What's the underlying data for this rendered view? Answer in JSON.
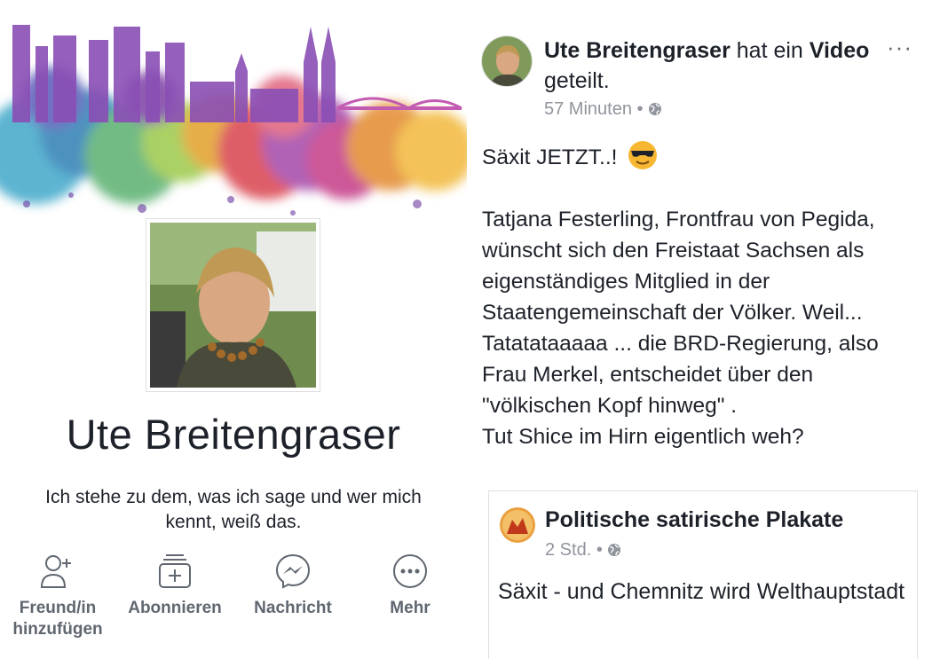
{
  "profile": {
    "name": "Ute Breitengraser",
    "bio": "Ich stehe zu dem, was ich sage und wer mich kennt, weiß das.",
    "actions": [
      {
        "label": "Freund/in hinzufügen",
        "icon": "add-friend-icon"
      },
      {
        "label": "Abonnieren",
        "icon": "subscribe-icon"
      },
      {
        "label": "Nachricht",
        "icon": "messenger-icon"
      },
      {
        "label": "Mehr",
        "icon": "more-icon"
      }
    ]
  },
  "post": {
    "author": "Ute Breitengraser",
    "action_text": " hat ein ",
    "object": "Video",
    "action_suffix": " geteilt.",
    "time": "57 Minuten",
    "separator": " • ",
    "more": "···",
    "lines": [
      "Säxit JETZT..!",
      "",
      "Tatjana Festerling, Frontfrau von Pegida, wünscht sich den Freistaat Sachsen als eigenständiges Mitglied in der Staatengemeinschaft der Völker. Weil... Tatatataaaaa ... die BRD-Regierung, also Frau Merkel, entscheidet über den \"völkischen Kopf hinweg\" .",
      "Tut Shice im Hirn eigentlich weh?"
    ],
    "emoji": "sunglasses-emoji"
  },
  "shared": {
    "page_name": "Politische satirische Plakate",
    "time": "2 Std.",
    "separator": " • ",
    "text": "Säxit - und Chemnitz wird Welthauptstadt"
  }
}
